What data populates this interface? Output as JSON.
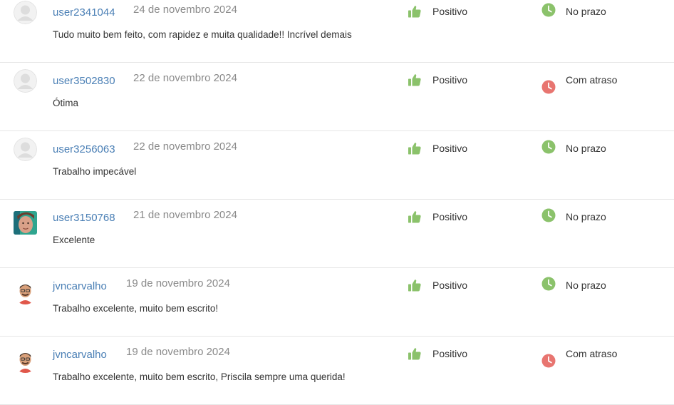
{
  "colors": {
    "username": "#4a7fb5",
    "positive": "#8bc26b",
    "on_time": "#8bc26b",
    "late": "#e87570",
    "date": "#8a8a8a"
  },
  "reviews": [
    {
      "avatar": "default-avatar-icon",
      "username": "user2341044",
      "date": "24 de novembro 2024",
      "comment": "Tudo muito bem feito, com rapidez e muita qualidade!! Incrível demais",
      "rating_icon": "thumbs-up-icon",
      "rating": "Positivo",
      "deadline_icon": "clock-icon",
      "deadline_status": "on_time",
      "deadline": "No prazo"
    },
    {
      "avatar": "default-avatar-icon",
      "username": "user3502830",
      "date": "22 de novembro 2024",
      "comment": "Ótima",
      "rating_icon": "thumbs-up-icon",
      "rating": "Positivo",
      "deadline_icon": "clock-icon",
      "deadline_status": "late",
      "deadline": "Com atraso"
    },
    {
      "avatar": "default-avatar-icon",
      "username": "user3256063",
      "date": "22 de novembro 2024",
      "comment": "Trabalho impecável",
      "rating_icon": "thumbs-up-icon",
      "rating": "Positivo",
      "deadline_icon": "clock-icon",
      "deadline_status": "on_time",
      "deadline": "No prazo"
    },
    {
      "avatar": "photo-avatar",
      "username": "user3150768",
      "date": "21 de novembro 2024",
      "comment": "Excelente",
      "rating_icon": "thumbs-up-icon",
      "rating": "Positivo",
      "deadline_icon": "clock-icon",
      "deadline_status": "on_time",
      "deadline": "No prazo"
    },
    {
      "avatar": "cartoon-avatar",
      "username": "jvncarvalho",
      "date": "19 de novembro 2024",
      "comment": "Trabalho excelente, muito bem escrito!",
      "rating_icon": "thumbs-up-icon",
      "rating": "Positivo",
      "deadline_icon": "clock-icon",
      "deadline_status": "on_time",
      "deadline": "No prazo"
    },
    {
      "avatar": "cartoon-avatar",
      "username": "jvncarvalho",
      "date": "19 de novembro 2024",
      "comment": "Trabalho excelente, muito bem escrito, Priscila sempre uma querida!",
      "rating_icon": "thumbs-up-icon",
      "rating": "Positivo",
      "deadline_icon": "clock-icon",
      "deadline_status": "late",
      "deadline": "Com atraso"
    }
  ]
}
